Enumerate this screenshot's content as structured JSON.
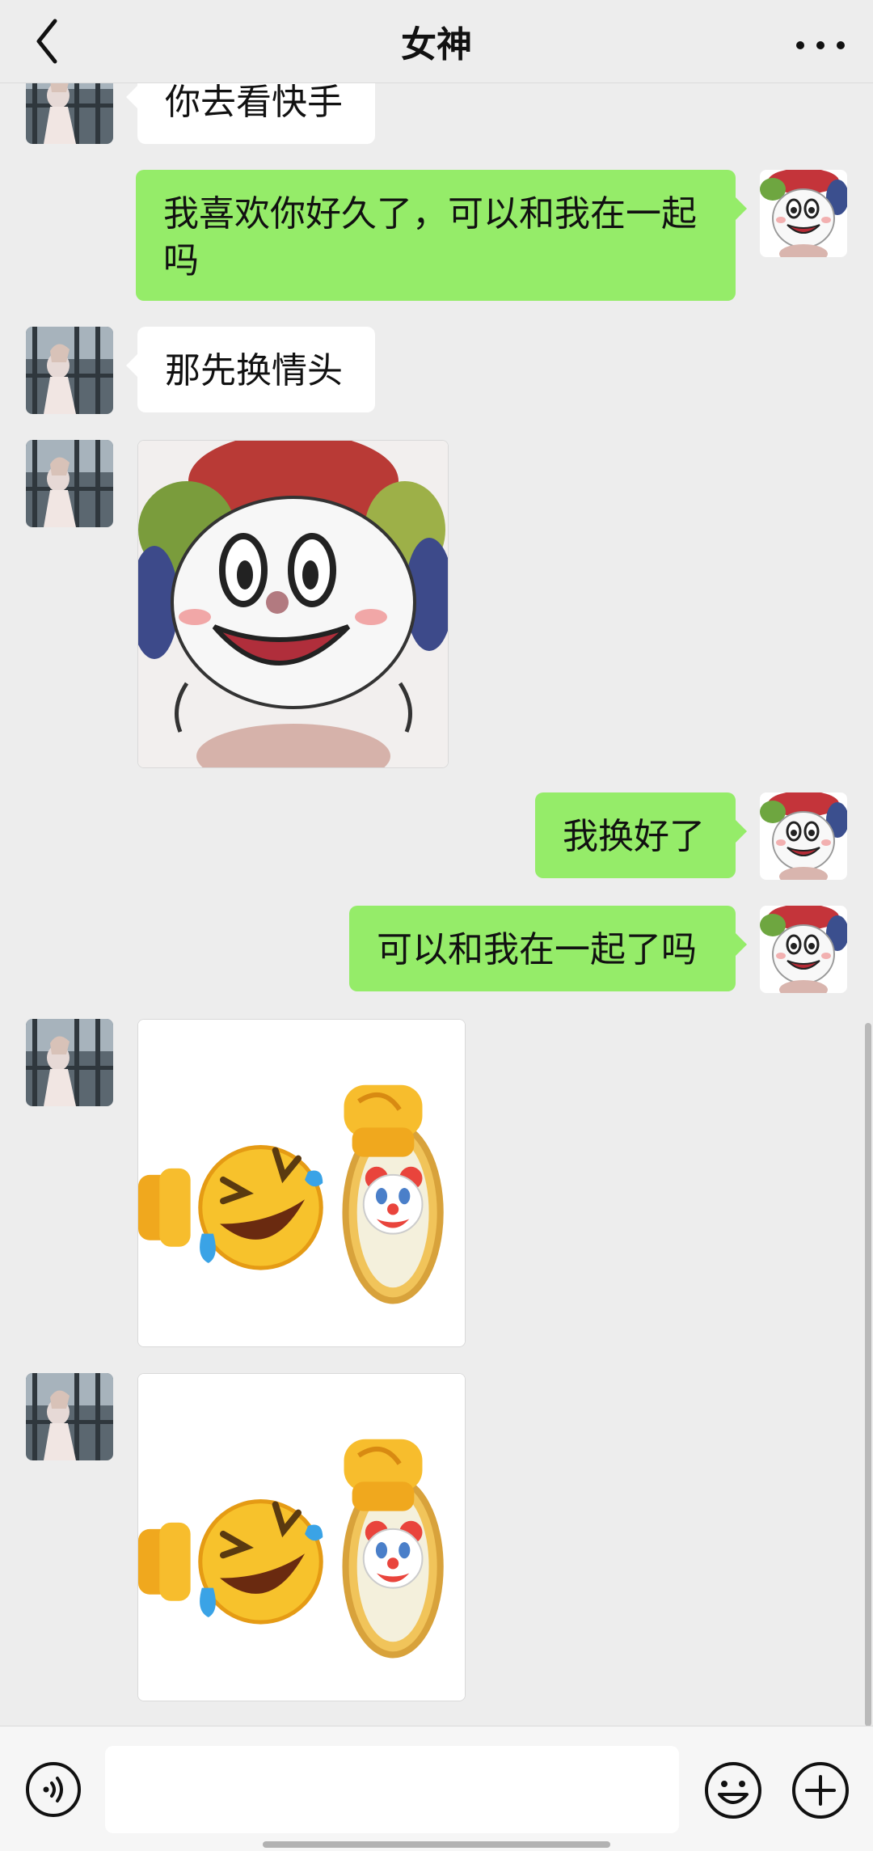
{
  "header": {
    "title": "女神"
  },
  "messages": {
    "m1": {
      "side": "in",
      "type": "text",
      "text": "你去看快手"
    },
    "m2": {
      "side": "out",
      "type": "text",
      "text": "我喜欢你好久了，可以和我在一起吗"
    },
    "m3": {
      "side": "in",
      "type": "text",
      "text": "那先换情头"
    },
    "m4": {
      "side": "in",
      "type": "sticker",
      "sticker": "clown-cartoon-sticker"
    },
    "m5": {
      "side": "out",
      "type": "text",
      "text": "我换好了"
    },
    "m6": {
      "side": "out",
      "type": "text",
      "text": "可以和我在一起了吗"
    },
    "m7": {
      "side": "in",
      "type": "sticker",
      "sticker": "laughing-emoji-clown-mirror-sticker"
    },
    "m8": {
      "side": "in",
      "type": "sticker",
      "sticker": "laughing-emoji-clown-mirror-sticker"
    }
  },
  "input_bar": {
    "placeholder": "",
    "value": ""
  },
  "icons": {
    "back": "chevron-left-icon",
    "more": "more-dots-icon",
    "voice": "voice-icon",
    "emoji": "emoji-icon",
    "add": "plus-icon"
  },
  "colors": {
    "background": "#ededed",
    "outgoing_bubble": "#95ec69",
    "incoming_bubble": "#ffffff"
  }
}
